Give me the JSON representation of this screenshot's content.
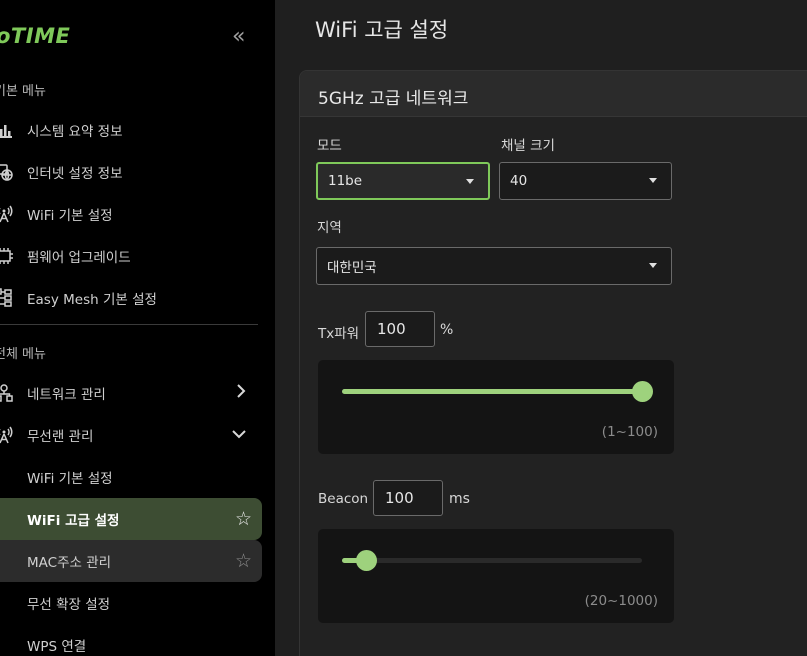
{
  "brand": {
    "logo_text": "oTIME",
    "accent": "#7fc95a"
  },
  "sidebar": {
    "collapse_icon": "«",
    "basic_title": "기본 메뉴",
    "basic_items": [
      {
        "label": "시스템 요약 정보",
        "icon": "bar-chart-icon"
      },
      {
        "label": "인터넷 설정 정보",
        "icon": "globe-icon"
      },
      {
        "label": "WiFi 기본 설정",
        "icon": "antenna-icon"
      },
      {
        "label": "펌웨어 업그레이드",
        "icon": "chip-icon"
      },
      {
        "label": "Easy Mesh 기본 설정",
        "icon": "mesh-icon"
      }
    ],
    "full_title": "전체 메뉴",
    "full_items": [
      {
        "label": "네트워크 관리",
        "icon": "network-icon",
        "chevron": "›"
      },
      {
        "label": "무선랜 관리",
        "icon": "antenna-icon",
        "chevron": "⌄"
      }
    ],
    "sub_items": [
      {
        "label": "WiFi 기본 설정"
      },
      {
        "label": "WiFi 고급 설정",
        "state": "active",
        "star": "☆"
      },
      {
        "label": "MAC주소 관리",
        "state": "hover",
        "star": "☆"
      },
      {
        "label": "무선 확장 설정"
      },
      {
        "label": "WPS 연결"
      }
    ]
  },
  "main": {
    "page_title": "WiFi 고급 설정",
    "panel_title": "5GHz 고급 네트워크",
    "mode": {
      "label": "모드",
      "value": "11be"
    },
    "channel_width": {
      "label": "채널 크기",
      "value": "40"
    },
    "region": {
      "label": "지역",
      "value": "대한민국"
    },
    "tx_power": {
      "label": "Tx파워",
      "value": "100",
      "unit": "%",
      "range": "(1~100)",
      "min": 1,
      "max": 100
    },
    "beacon": {
      "label": "Beacon",
      "value": "100",
      "unit": "ms",
      "range": "(20~1000)",
      "min": 20,
      "max": 1000
    }
  }
}
